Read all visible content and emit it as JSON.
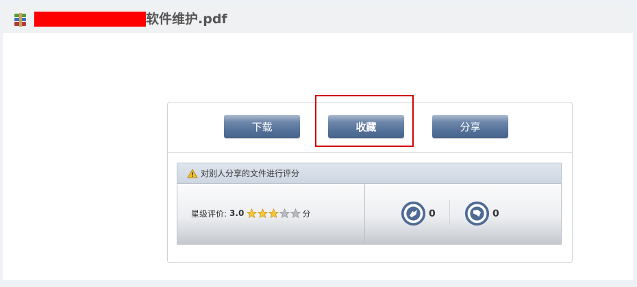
{
  "header": {
    "file_name_suffix": "软件维护.pdf",
    "file_icon": "winrar-archive-icon"
  },
  "actions": {
    "download_label": "下载",
    "favorite_label": "收藏",
    "share_label": "分享"
  },
  "rating": {
    "title": "对别人分享的文件进行评分",
    "title_icon": "warning-icon",
    "star_label": "星级评价:",
    "star_value": "3.0",
    "stars_filled": 3,
    "stars_total": 5,
    "star_suffix": "分",
    "up_count": "0",
    "down_count": "0"
  },
  "colors": {
    "button": "#4f6d96",
    "highlight": "#d00000",
    "redaction": "#ff0000",
    "star": "#f6c53a",
    "vote_icon": "#4e6b95"
  }
}
